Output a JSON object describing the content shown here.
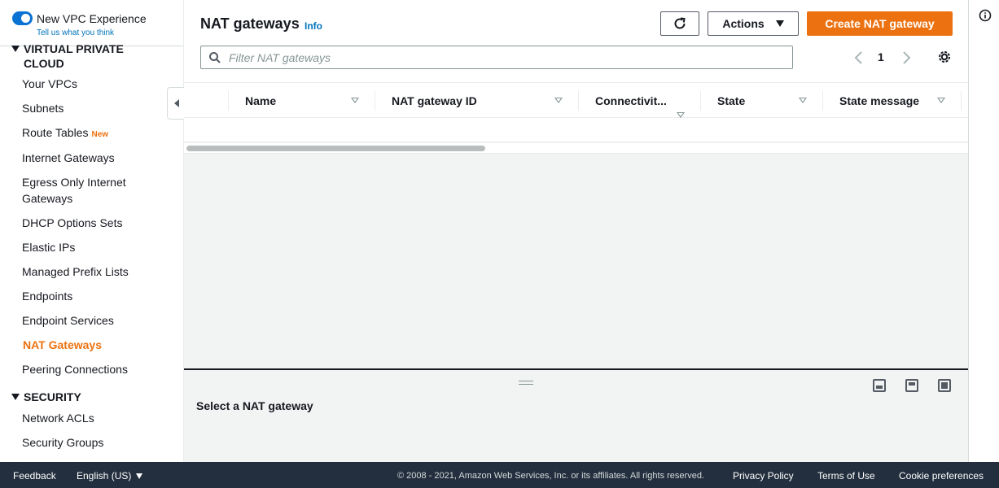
{
  "sidebar": {
    "toggle_label": "New VPC Experience",
    "toggle_sublink": "Tell us what you think",
    "section_vpc": "VIRTUAL PRIVATE CLOUD",
    "items": [
      {
        "label": "Your VPCs"
      },
      {
        "label": "Subnets"
      },
      {
        "label": "Route Tables",
        "badge": "New"
      },
      {
        "label": "Internet Gateways"
      },
      {
        "label": "Egress Only Internet Gateways"
      },
      {
        "label": "DHCP Options Sets"
      },
      {
        "label": "Elastic IPs"
      },
      {
        "label": "Managed Prefix Lists"
      },
      {
        "label": "Endpoints"
      },
      {
        "label": "Endpoint Services"
      },
      {
        "label": "NAT Gateways",
        "active": true
      },
      {
        "label": "Peering Connections"
      }
    ],
    "section_security": "SECURITY",
    "security_items": [
      {
        "label": "Network ACLs"
      },
      {
        "label": "Security Groups"
      }
    ]
  },
  "header": {
    "title": "NAT gateways",
    "info": "Info",
    "actions_label": "Actions",
    "create_label": "Create NAT gateway"
  },
  "filter": {
    "placeholder": "Filter NAT gateways",
    "value": ""
  },
  "pagination": {
    "current_page": "1"
  },
  "table": {
    "columns": [
      "Name",
      "NAT gateway ID",
      "Connectivit...",
      "State",
      "State message"
    ],
    "rows": []
  },
  "split_panel": {
    "title": "Select a NAT gateway"
  },
  "footer": {
    "feedback": "Feedback",
    "language": "English (US)",
    "copyright": "© 2008 - 2021, Amazon Web Services, Inc. or its affiliates. All rights reserved.",
    "privacy": "Privacy Policy",
    "terms": "Terms of Use",
    "cookies": "Cookie preferences"
  },
  "colors": {
    "accent": "#ec7211",
    "link": "#0073bb",
    "footer_bg": "#232f3e"
  }
}
